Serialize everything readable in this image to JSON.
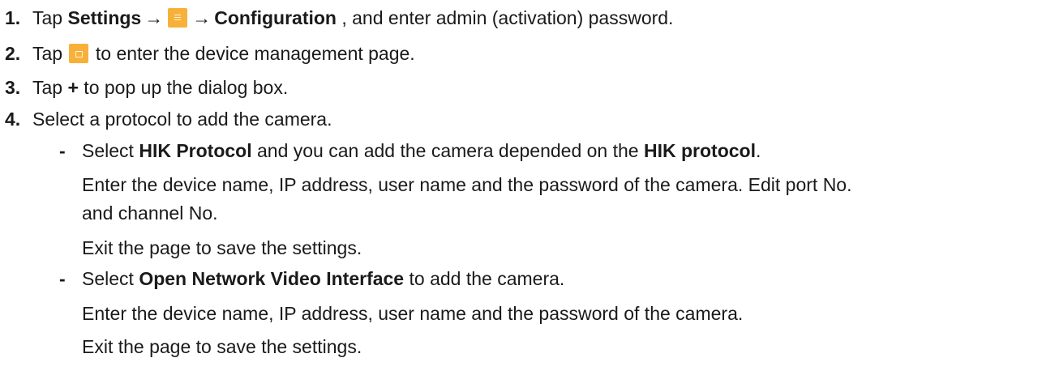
{
  "steps": {
    "s1": {
      "num": "1.",
      "t1": "Tap ",
      "b1": "Settings",
      "arrow1": "→",
      "icon1": "menu-icon",
      "arrow2": "→",
      "b2": "Configuration",
      "t2": " , and enter admin (activation) password."
    },
    "s2": {
      "num": "2.",
      "t1": "Tap ",
      "icon1": "device-management-icon",
      "t2": " to enter the device management page."
    },
    "s3": {
      "num": "3.",
      "t1": "Tap ",
      "b1": "+",
      "t2": " to pop up the dialog box."
    },
    "s4": {
      "num": "4.",
      "text": "Select a protocol to add the camera."
    }
  },
  "options": {
    "hik": {
      "bullet": "-",
      "t1": "Select ",
      "b1": "HIK Protocol",
      "t2": " and you can add the camera depended on the ",
      "b2": "HIK protocol",
      "t3": ".",
      "para1_line1": "Enter the device name, IP address, user name and the password of the camera. Edit port No.",
      "para1_line2": "and channel No.",
      "para2": "Exit the page to save the settings."
    },
    "onvif": {
      "bullet": "-",
      "t1": "Select ",
      "b1": "Open Network Video Interface",
      "t2": " to add the camera.",
      "para1": "Enter the device name, IP address, user name and the password of the camera.",
      "para2": "Exit the page to save the settings."
    }
  },
  "colors": {
    "icon_bg": "#f7b13a",
    "text": "#1a1a1a"
  }
}
